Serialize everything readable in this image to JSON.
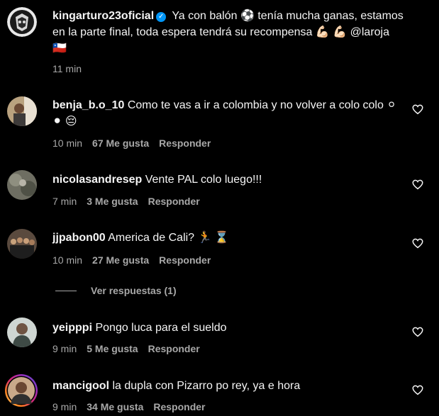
{
  "post": {
    "username": "kingarturo23oficial",
    "caption": "Ya con balón ⚽ tenía mucha ganas, estamos en la parte final, toda espera tendrá su recompensa 💪🏻 💪🏻 @laroja 🇨🇱",
    "time": "11 min"
  },
  "comments": [
    {
      "username": "benja_b.o_10",
      "text": "Como te vas a ir a colombia y no volver a colo colo ⚪ ⚫ 😔",
      "time": "10 min",
      "likes": "67 Me gusta",
      "reply": "Responder"
    },
    {
      "username": "nicolasandresep",
      "text": "Vente PAL colo luego!!!",
      "time": "7 min",
      "likes": "3 Me gusta",
      "reply": "Responder"
    },
    {
      "username": "jjpabon00",
      "text": "America de Cali? 🏃 ⌛",
      "time": "10 min",
      "likes": "27 Me gusta",
      "reply": "Responder"
    },
    {
      "username": "yeipppi",
      "text": "Pongo luca para el sueldo",
      "time": "9 min",
      "likes": "5 Me gusta",
      "reply": "Responder"
    },
    {
      "username": "mancigool",
      "text": "la dupla con Pizarro po rey, ya e hora",
      "time": "9 min",
      "likes": "34 Me gusta",
      "reply": "Responder"
    }
  ],
  "view_replies": "Ver respuestas (1)",
  "icons": {
    "like": "heart-outline-icon",
    "verified": "verified-badge-icon"
  },
  "colors": {
    "background": "#000000",
    "text": "#f5f5f5",
    "muted": "#a8a8a8",
    "verified": "#0095f6",
    "story_ring": "#d62976"
  }
}
